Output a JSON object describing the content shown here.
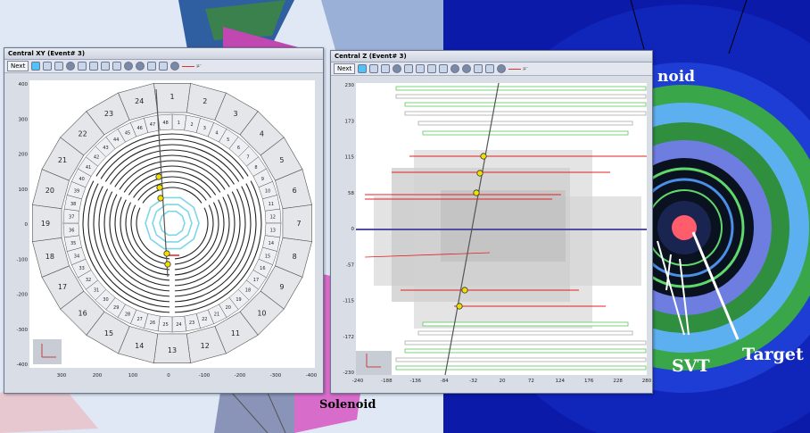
{
  "left_window": {
    "title": "Central XY (Event# 3)",
    "next_label": "Next",
    "legend_label": "µ⁻",
    "y_ticks": [
      "400",
      "300",
      "200",
      "100",
      "0",
      "-100",
      "-200",
      "-300",
      "-400"
    ],
    "x_ticks": [
      "300",
      "200",
      "100",
      "0",
      "-100",
      "-200",
      "-300",
      "-400"
    ],
    "outer_sectors": [
      "1",
      "2",
      "3",
      "4",
      "5",
      "6",
      "7",
      "8",
      "9",
      "10",
      "11",
      "12",
      "13",
      "14",
      "15",
      "16",
      "17",
      "18",
      "19",
      "20",
      "21",
      "22",
      "23",
      "24"
    ],
    "inner_sectors": [
      "1",
      "2",
      "3",
      "4",
      "5",
      "6",
      "7",
      "8",
      "9",
      "10",
      "11",
      "12",
      "13",
      "14",
      "15",
      "16",
      "17",
      "18",
      "19",
      "20",
      "21",
      "22",
      "23",
      "24",
      "25",
      "26",
      "27",
      "28",
      "29",
      "30",
      "31",
      "32",
      "33",
      "34",
      "35",
      "36",
      "37",
      "38",
      "39",
      "40",
      "41",
      "42",
      "43",
      "44",
      "45",
      "46",
      "47",
      "48"
    ]
  },
  "right_window": {
    "title": "Central Z (Event# 3)",
    "next_label": "Next",
    "legend_label": "µ⁻",
    "y_ticks": [
      "230",
      "173",
      "115",
      "58",
      "0",
      "-57",
      "-115",
      "-172",
      "-230"
    ],
    "x_ticks": [
      "-240",
      "-188",
      "-136",
      "-84",
      "-32",
      "20",
      "72",
      "124",
      "176",
      "228",
      "280"
    ]
  },
  "overlay_labels": {
    "solenoid_top": "noid",
    "solenoid_bottom": "Solenoid",
    "svt": "SVT",
    "target": "Target"
  },
  "colors": {
    "track": "#e02020",
    "svt": "#7fd6e8",
    "hit": "#f0e000",
    "detector_blue": "#0b1aa8"
  }
}
